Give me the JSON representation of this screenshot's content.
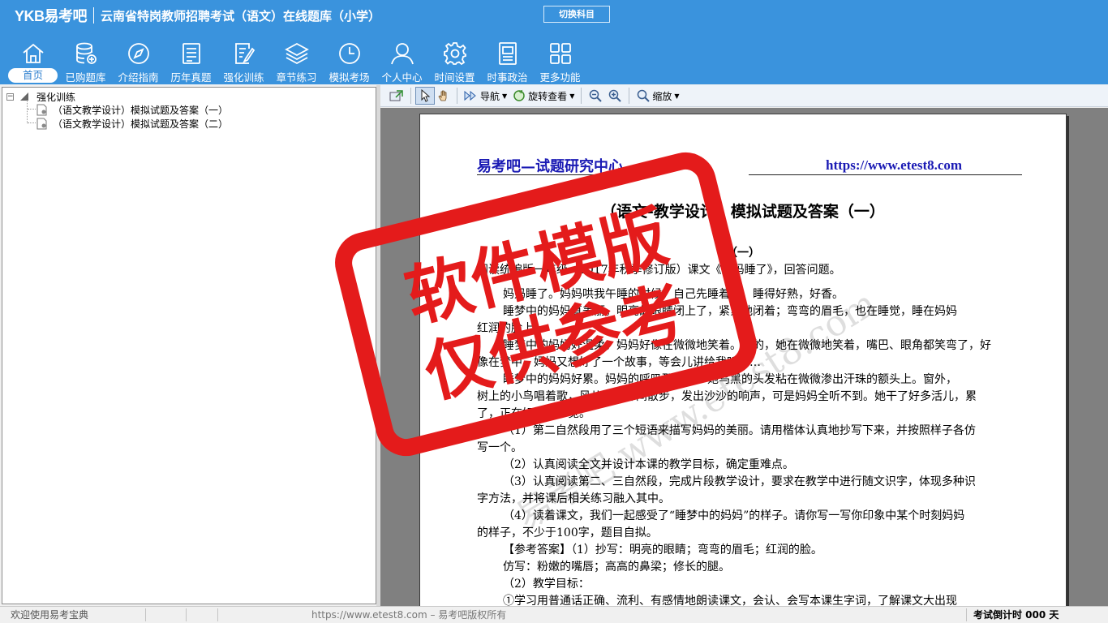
{
  "header": {
    "logo": "YKB易考吧",
    "app_title": "云南省特岗教师招聘考试（语文）在线题库（小学）",
    "switch_subject": "切换科目"
  },
  "nav": [
    {
      "label": "首页",
      "icon": "home-icon",
      "active": true
    },
    {
      "label": "已购题库",
      "icon": "database-add-icon"
    },
    {
      "label": "介绍指南",
      "icon": "compass-icon"
    },
    {
      "label": "历年真题",
      "icon": "checklist-icon"
    },
    {
      "label": "强化训练",
      "icon": "edit-document-icon"
    },
    {
      "label": "章节练习",
      "icon": "layers-icon"
    },
    {
      "label": "模拟考场",
      "icon": "clock-icon"
    },
    {
      "label": "个人中心",
      "icon": "user-icon"
    },
    {
      "label": "时间设置",
      "icon": "gear-icon"
    },
    {
      "label": "时事政治",
      "icon": "news-icon"
    },
    {
      "label": "更多功能",
      "icon": "grid-icon"
    }
  ],
  "tree": {
    "root": "强化训练",
    "items": [
      "（语文教学设计）模拟试题及答案（一）",
      "（语文教学设计）模拟试题及答案（二）"
    ]
  },
  "toolbar": {
    "nav_label": "导航",
    "rotate_label": "旋转查看",
    "zoom_label": "缩放"
  },
  "document": {
    "header_left": "易考吧—试题研究中心",
    "header_right": "https://www.etest8.com",
    "title": "（语文-教学设计）模拟试题及答案（一）",
    "subtitle": "（一）",
    "lines": [
      "阅读统编版一年级（2017年秋季修订版）课文《妈妈睡了》，回答问题。",
      "妈妈睡了。妈妈哄我午睡的时候，自己先睡着了，睡得好熟，好香。",
      "睡梦中的妈妈真美丽。明亮的眼睛闭上了，紧紧地闭着；弯弯的眉毛，也在睡觉，睡在妈妈",
      "红润的脸上。",
      "睡梦中的妈妈好温柔。妈妈好像在微微地笑着。是的，她在微微地笑着，嘴巴、眼角都笑弯了，好",
      "像在梦中，妈妈又想好了一个故事，等会儿讲给我听……",
      "睡梦中的妈妈好累。妈妈的呼吸那么沉。她乌黑的头发粘在微微渗出汗珠的额头上。窗外，",
      "树上的小鸟唱着歌，风儿在树叶间散步，发出沙沙的响声，可是妈妈全听不到。她干了好多活儿，累",
      "了，正在好好睡一觉。",
      "（1）第二自然段用了三个短语来描写妈妈的美丽。请用楷体认真地抄写下来，并按照样子各仿",
      "写一个。",
      "（2）认真阅读全文并设计本课的教学目标，确定重难点。",
      "（3）认真阅读第二、三自然段，完成片段教学设计，要求在教学中进行随文识字，体现多种识",
      "字方法，并将课后相关练习融入其中。",
      "（4）读着课文，我们一起感受了“睡梦中的妈妈”的样子。请你写一写你印象中某个时刻妈妈",
      "的样子，不少于100字，题目自拟。",
      "【参考答案】（1）抄写：明亮的眼睛；弯弯的眉毛；红润的脸。",
      "仿写：粉嫩的嘴唇；高高的鼻梁；修长的腿。",
      "（2）教学目标：",
      "①学习用普通话正确、流利、有感情地朗读课文，会认、会写本课生字词，了解课文大出现"
    ]
  },
  "stamp": {
    "line1": "软件模版",
    "line2": "仅供参考"
  },
  "watermark": "易考吧 www.etest8.com",
  "status": {
    "welcome": "欢迎使用易考宝典",
    "copyright": "https://www.etest8.com – 易考吧版权所有",
    "countdown": "考试倒计时 000 天"
  },
  "colors": {
    "header_bg": "#3a93dd",
    "stamp_red": "#e41b1b",
    "doc_blue": "#1a1ab4"
  }
}
